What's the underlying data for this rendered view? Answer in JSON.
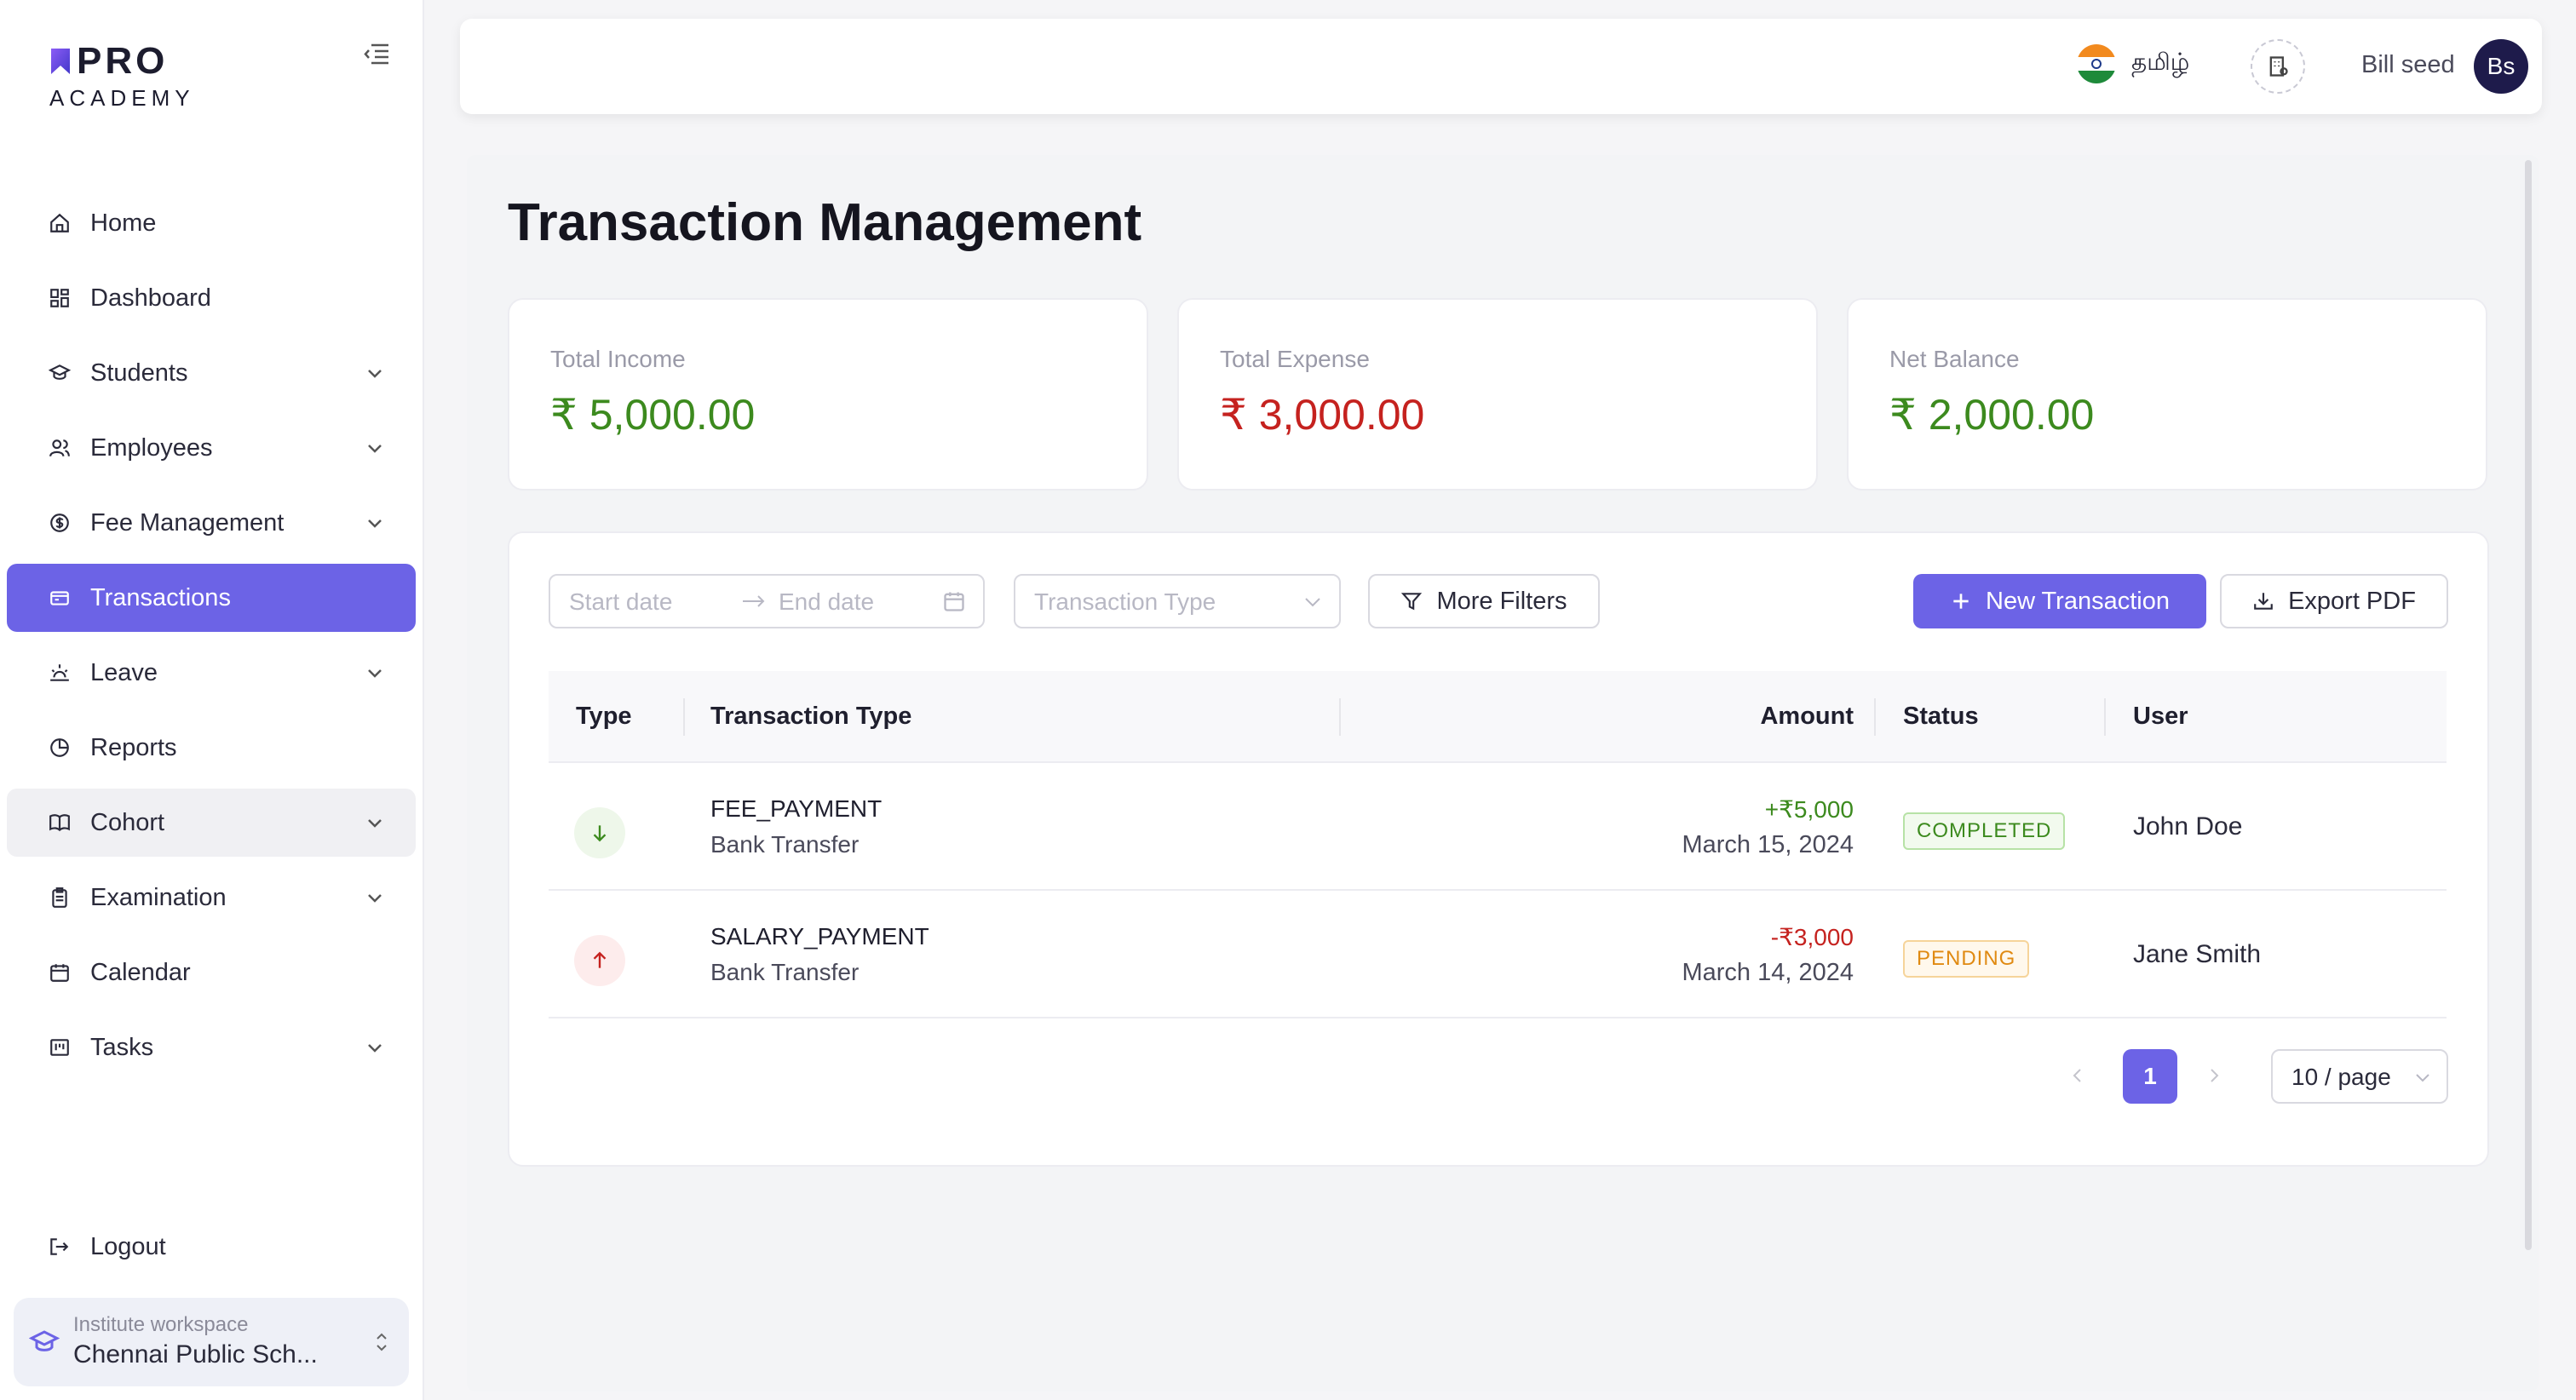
{
  "brand": {
    "name_top": "PRO",
    "name_bottom": "ACADEMY",
    "accent": "#6c63e6"
  },
  "sidebar": {
    "items": [
      {
        "label": "Home",
        "icon": "home-icon",
        "expandable": false
      },
      {
        "label": "Dashboard",
        "icon": "grid-icon",
        "expandable": false
      },
      {
        "label": "Students",
        "icon": "graduation-icon",
        "expandable": true
      },
      {
        "label": "Employees",
        "icon": "users-icon",
        "expandable": true
      },
      {
        "label": "Fee Management",
        "icon": "dollar-circle-icon",
        "expandable": true
      },
      {
        "label": "Transactions",
        "icon": "wallet-icon",
        "expandable": false,
        "active": true
      },
      {
        "label": "Leave",
        "icon": "sunrise-icon",
        "expandable": true
      },
      {
        "label": "Reports",
        "icon": "pie-chart-icon",
        "expandable": false
      },
      {
        "label": "Cohort",
        "icon": "book-icon",
        "expandable": true,
        "hover": true
      },
      {
        "label": "Examination",
        "icon": "clipboard-icon",
        "expandable": true
      },
      {
        "label": "Calendar",
        "icon": "calendar-icon",
        "expandable": false
      },
      {
        "label": "Tasks",
        "icon": "kanban-icon",
        "expandable": true
      }
    ],
    "logout_label": "Logout",
    "workspace": {
      "label": "Institute workspace",
      "name": "Chennai Public Sch..."
    }
  },
  "header": {
    "language": "தமிழ்",
    "user_name": "Bill seed",
    "avatar_initials": "Bs"
  },
  "page": {
    "title": "Transaction Management"
  },
  "stats": [
    {
      "label": "Total Income",
      "value": "₹ 5,000.00",
      "color": "#3c8a1e"
    },
    {
      "label": "Total Expense",
      "value": "₹ 3,000.00",
      "color": "#c5221f"
    },
    {
      "label": "Net Balance",
      "value": "₹ 2,000.00",
      "color": "#3c8a1e"
    }
  ],
  "filters": {
    "start_placeholder": "Start date",
    "end_placeholder": "End date",
    "type_placeholder": "Transaction Type",
    "more_filters": "More Filters",
    "new_transaction": "New Transaction",
    "export_pdf": "Export PDF"
  },
  "table": {
    "columns": [
      "Type",
      "Transaction Type",
      "Amount",
      "Status",
      "User"
    ],
    "rows": [
      {
        "direction": "in",
        "type": "FEE_PAYMENT",
        "method": "Bank Transfer",
        "amount": "+₹5,000",
        "date": "March 15, 2024",
        "status": "COMPLETED",
        "user": "John Doe"
      },
      {
        "direction": "out",
        "type": "SALARY_PAYMENT",
        "method": "Bank Transfer",
        "amount": "-₹3,000",
        "date": "March 14, 2024",
        "status": "PENDING",
        "user": "Jane Smith"
      }
    ]
  },
  "pagination": {
    "current_page": "1",
    "page_size": "10 / page"
  }
}
